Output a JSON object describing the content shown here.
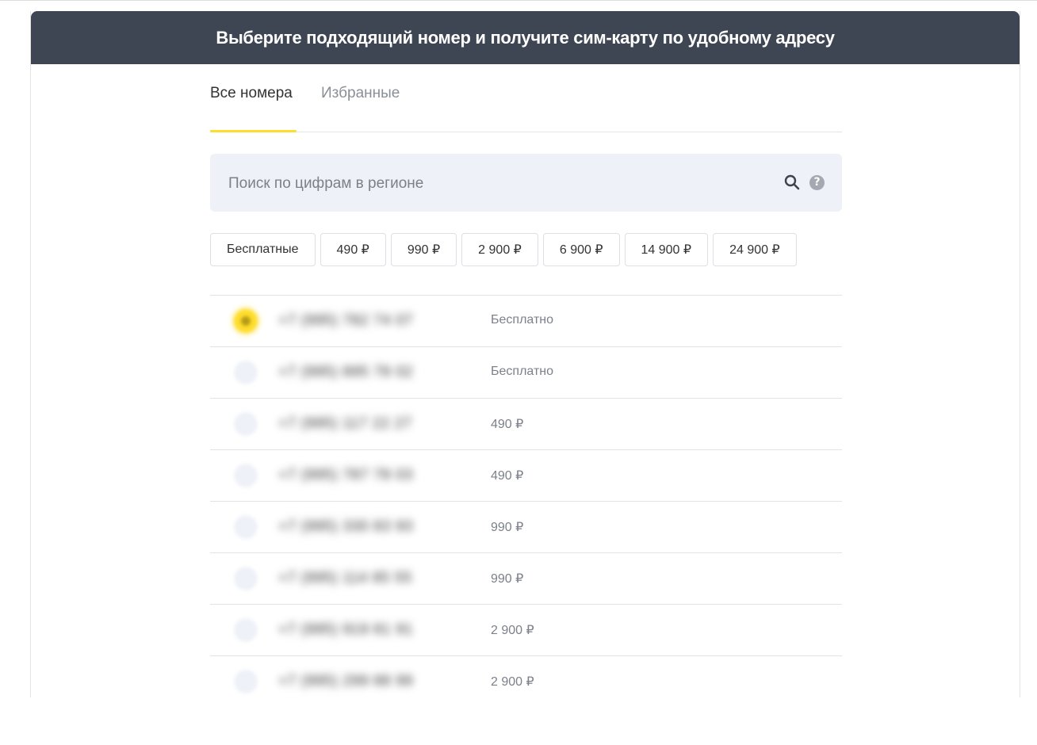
{
  "banner": {
    "title": "Выберите подходящий номер и получите сим-карту по удобному адресу"
  },
  "tabs": [
    {
      "label": "Все номера",
      "active": true
    },
    {
      "label": "Избранные",
      "active": false
    }
  ],
  "search": {
    "placeholder": "Поиск по цифрам в регионе",
    "value": "",
    "icons": [
      "search-icon",
      "question-circle-icon"
    ],
    "help_glyph": "?"
  },
  "filters": [
    "Бесплатные",
    "490 ₽",
    "990 ₽",
    "2 900 ₽",
    "6 900 ₽",
    "14 900 ₽",
    "24 900 ₽"
  ],
  "numbers": [
    {
      "phone": "+7 (995) 782 74 07",
      "price": "Бесплатно",
      "selected": true
    },
    {
      "phone": "+7 (995) 895 78 02",
      "price": "Бесплатно",
      "selected": false
    },
    {
      "phone": "+7 (995) 117 22 27",
      "price": "490 ₽",
      "selected": false
    },
    {
      "phone": "+7 (995) 787 78 03",
      "price": "490 ₽",
      "selected": false
    },
    {
      "phone": "+7 (995) 330 83 93",
      "price": "990 ₽",
      "selected": false
    },
    {
      "phone": "+7 (995) 114 85 55",
      "price": "990 ₽",
      "selected": false
    },
    {
      "phone": "+7 (995) 919 81 91",
      "price": "2 900 ₽",
      "selected": false
    },
    {
      "phone": "+7 (995) 299 88 99",
      "price": "2 900 ₽",
      "selected": false
    }
  ],
  "colors": {
    "banner_bg": "#3e4654",
    "accent": "#ffdd2d",
    "search_bg": "#eef1f7"
  }
}
